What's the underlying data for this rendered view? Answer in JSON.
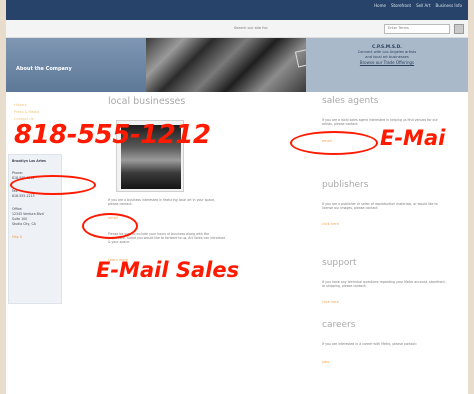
{
  "topnav": [
    "Home",
    "Storefront",
    "Sell Art",
    "Business Info"
  ],
  "search": {
    "label": "Search our site for:",
    "placeholder": "Enter Terms"
  },
  "header": {
    "section_title": "About the Company",
    "sign_text": "METRO",
    "promo": {
      "line1": "C.P.S.M.S.D.",
      "line2": "Connect with Los Angeles artists",
      "line3": "and local art businesses",
      "link": "Browse our Trade Offerings"
    }
  },
  "sidebar": {
    "links": [
      "History",
      "Press & Media",
      "Contact Us"
    ],
    "box": {
      "title": "Brooklyn Los Artes",
      "phone_label": "Phone:",
      "phone": "818-555-1212",
      "fax_label": "Fax:",
      "fax": "818-555-1213",
      "office_label": "Office:",
      "address1": "12345 Ventura Blvd",
      "address2": "Suite 100",
      "address3": "Studio City, CA",
      "link": "Map It"
    }
  },
  "center": {
    "heading": "local businesses",
    "para1": "If you are a business interested in featuring local art in your space, please contact:",
    "email_link": "email",
    "para2": "Please be sure to include your hours of business along with the paperwork. Some you would like to forward to us. Art Sales can introduce & your space.",
    "bottom_link": "Learn more"
  },
  "right": {
    "sales": {
      "heading": "sales agents",
      "text": "If you are a local sales agent interested in helping us find venues for our artists, please contact:",
      "link": "email"
    },
    "publishers": {
      "heading": "publishers",
      "text": "If you are a publisher or seller of reproduction materials, or would like to license our images, please contact:",
      "link": "click here"
    },
    "support": {
      "heading": "support",
      "text": "If you have any technical questions regarding your Metro account, storefront, or shipping, please contact:",
      "link": "click here"
    },
    "careers": {
      "heading": "careers",
      "text": "If you are interested in a career with Metro, please contact:",
      "link": "jobs"
    }
  },
  "annotations": {
    "phone": "818-555-1212",
    "email_right": "E-Mai",
    "email_sales": "E-Mail Sales",
    "color": "#ff1a00"
  }
}
